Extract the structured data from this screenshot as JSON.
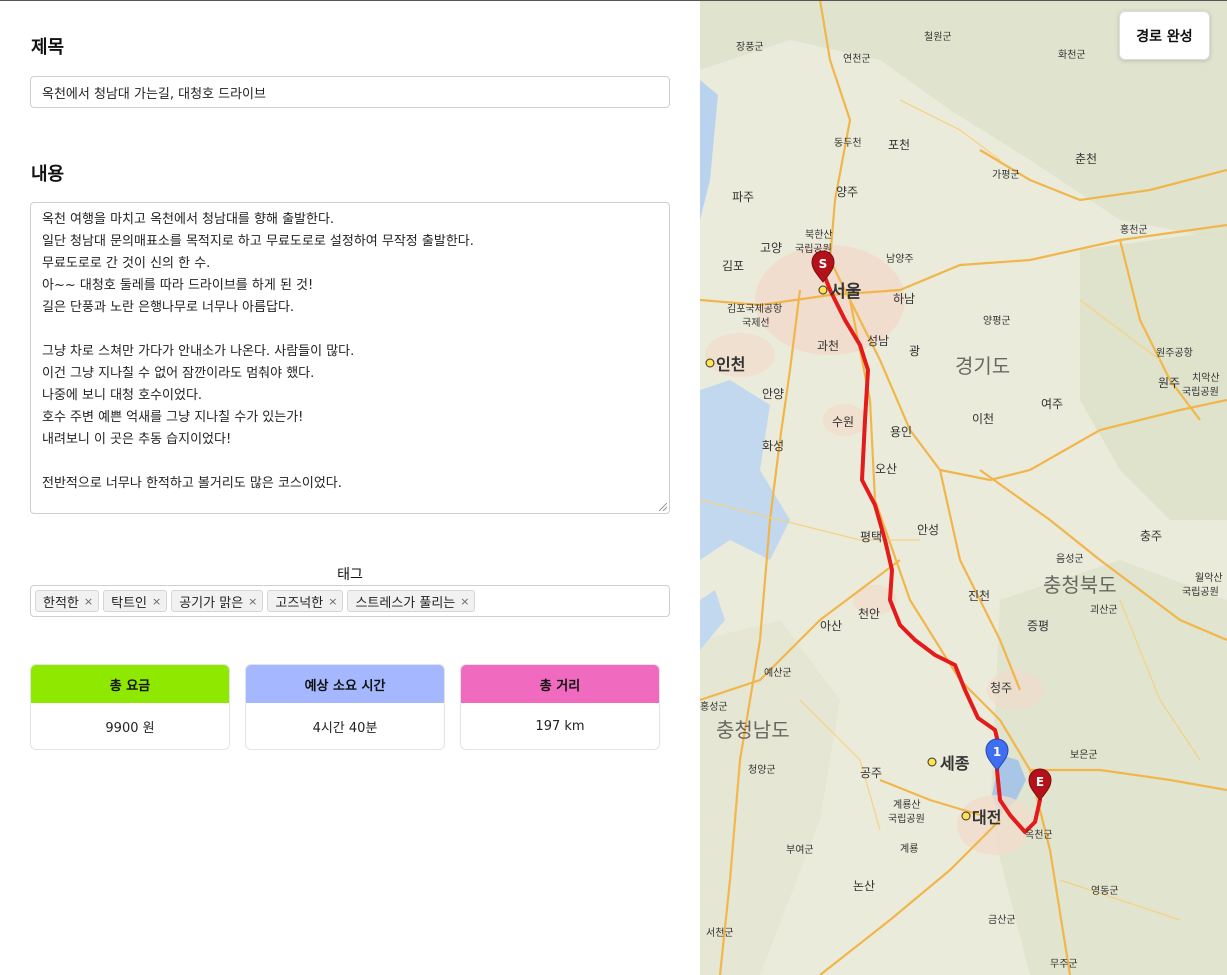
{
  "form": {
    "title_heading": "제목",
    "title_value": "옥천에서 청남대 가는길, 대청호 드라이브",
    "content_heading": "내용",
    "content_lines": [
      "옥천 여행을 마치고 옥천에서 청남대를 향해 출발한다.",
      "일단 청남대 문의매표소를 목적지로 하고 무료도로로 설정하여 무작정 출발한다.",
      "무료도로로 간 것이 신의 한 수.",
      "아~~ 대청호 둘레를 따라 드라이브를 하게 된 것!",
      "길은 단풍과 노란 은행나무로 너무나 아름답다.",
      "",
      "그냥 차로 스쳐만 가다가 안내소가 나온다. 사람들이 많다.",
      "이건 그냥 지나칠 수 없어 잠깐이라도 멈춰야 했다.",
      "나중에 보니 대청 호수이었다.",
      "호수 주변 예쁜 억새를 그냥 지나칠 수가 있는가!",
      "내려보니 이 곳은 추동 습지이었다!",
      "",
      "전반적으로 너무나 한적하고 볼거리도 많은 코스이었다."
    ],
    "tag_heading": "태그",
    "tags": [
      "한적한",
      "탁트인",
      "공기가 맑은",
      "고즈넉한",
      "스트레스가 풀리는"
    ],
    "tag_remove_glyph": "×"
  },
  "stats": [
    {
      "label": "총 요금",
      "value": "9900 원",
      "color": "#8fe800"
    },
    {
      "label": "예상 소요 시간",
      "value": "4시간 40분",
      "color": "#a5b8ff"
    },
    {
      "label": "총 거리",
      "value": "197 km",
      "color": "#f06bc0"
    }
  ],
  "map": {
    "complete_button": "경로 완성",
    "route_color": "#e31b1b",
    "markers": {
      "start": "S",
      "waypoint": "1",
      "end": "E"
    },
    "place_labels": {
      "seoul": "서울",
      "incheon": "인천",
      "sejong": "세종",
      "daejeon": "대전",
      "gyeonggi": "경기도",
      "chungbuk": "충청북도",
      "chungnam": "충청남도",
      "cheongju": "청주",
      "cheonan": "천안",
      "pyeongtaek": "평택",
      "suwon": "수원",
      "osan": "오산",
      "yongin": "용인",
      "icheon": "이천",
      "anseong": "안성",
      "chuncheon": "춘천",
      "wonju": "원주",
      "chungju": "충주",
      "gongju": "공주",
      "nonsan": "논산",
      "asan": "아산",
      "jincheon": "진천",
      "jeungpyeong": "증평",
      "seongnam": "성남",
      "hanam": "하남",
      "gimpo": "김포",
      "goyang": "고양",
      "yangju": "양주",
      "pocheon": "포천",
      "paju": "파주",
      "gwacheon": "과천",
      "anyang": "안양",
      "hwaseong": "화성",
      "yeoju": "여주",
      "gapyeong": "가평군",
      "namyangju": "남양주",
      "dongducheon": "동두천",
      "yangpyeong": "양평군",
      "gyeryong": "계룡",
      "boeun": "보은군",
      "okcheon": "옥천군",
      "yeongdong": "영동군",
      "geumsan": "금산군",
      "cheongyang": "청양군",
      "yesan": "예산군",
      "hongseong": "홍성군",
      "buyeo": "부여군",
      "seocheon": "서천군",
      "muju": "무주군",
      "goesan": "괴산군",
      "eumseong": "음성군",
      "cheorwon": "철원군",
      "hwacheon": "화천군",
      "hongcheon": "홍천군",
      "yeoncheon": "연천군",
      "jangpung": "장풍군",
      "gwangju": "광",
      "gimpo_airport": "김포국제공항",
      "gukjeseon": "국제선",
      "wonju_airport": "원주공항",
      "chiak": "치악산",
      "chiak2": "국립공원",
      "bukhan": "북한산",
      "bukhan2": "국립공원",
      "gyeryong_park": "계룡산",
      "gyeryong_park2": "국립공원",
      "woraksan": "월악산",
      "woraksan2": "국립공원"
    }
  }
}
